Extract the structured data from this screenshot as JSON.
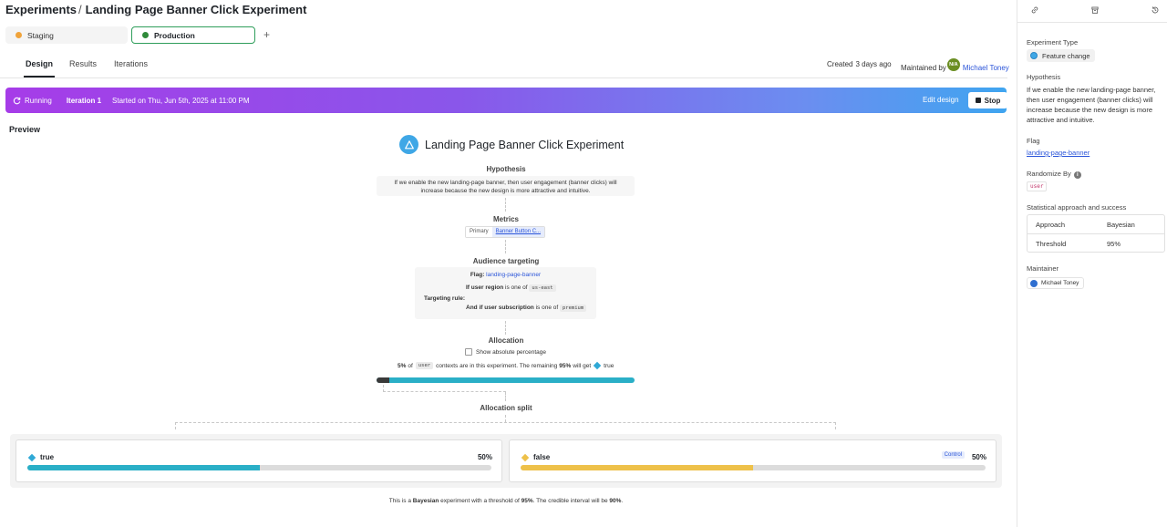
{
  "breadcrumb": {
    "root": "Experiments",
    "separator": "/",
    "current": "Landing Page Banner Click Experiment"
  },
  "environments": [
    {
      "name": "Staging",
      "color": "#f0a33a",
      "active": false
    },
    {
      "name": "Production",
      "color": "#2f8a3a",
      "active": true
    }
  ],
  "env_add_label": "+",
  "tabs": {
    "design": "Design",
    "results": "Results",
    "iterations": "Iterations",
    "active": "Design"
  },
  "meta": {
    "created_label": "Created",
    "created_value": "3 days ago",
    "maintained_by_label": "Maintained by",
    "avatar_initials": "N/A",
    "maintainer_name": "Michael Toney"
  },
  "banner": {
    "status": "Running",
    "iteration": "Iteration 1",
    "started": "Started on Thu, Jun 5th, 2025 at 11:00 PM",
    "edit_label": "Edit design",
    "stop_label": "Stop"
  },
  "preview": {
    "label": "Preview",
    "title": "Landing Page Banner Click Experiment",
    "hypothesis_title": "Hypothesis",
    "hypothesis_line1": "If we enable the new landing-page banner, then user engagement (banner clicks) will",
    "hypothesis_line2": "increase because the new design is more attractive and intuitive.",
    "metrics_title": "Metrics",
    "metric_primary_label": "Primary",
    "metric_primary_value": "Banner Button C...",
    "audience_title": "Audience targeting",
    "audience_flag_label": "Flag:",
    "audience_flag_value": "landing-page-banner",
    "targeting_rule_label": "Targeting rule:",
    "cond1": {
      "prefix": "If",
      "attr": "user region",
      "op": "is one of",
      "value": "us-east"
    },
    "cond2": {
      "prefix": "And if",
      "attr": "user subscription",
      "op": "is one of",
      "value": "premium"
    },
    "allocation_title": "Allocation",
    "show_absolute_label": "Show absolute percentage",
    "alloc_pct": "5%",
    "alloc_of": "of",
    "alloc_context": "user",
    "alloc_mid": "contexts are in this experiment. The remaining",
    "alloc_remaining": "95%",
    "alloc_will_get": "will get",
    "alloc_default": "true",
    "alloc_fraction": 0.05,
    "split_title": "Allocation split",
    "variations": [
      {
        "name": "true",
        "percent": "50%",
        "fraction": 0.5,
        "color": "#2aafc7",
        "control": false
      },
      {
        "name": "false",
        "percent": "50%",
        "fraction": 0.5,
        "color": "#eec14a",
        "control": true,
        "control_label": "Control"
      }
    ],
    "footer": {
      "t1": "This is a",
      "approach": "Bayesian",
      "t2": "experiment with a threshold of",
      "threshold": "95%",
      "t3": ". The credible interval will be",
      "interval": "90%",
      "t4": "."
    }
  },
  "sidebar": {
    "type_label": "Experiment Type",
    "type_value": "Feature change",
    "hypothesis_label": "Hypothesis",
    "hypothesis_text": "If we enable the new landing-page banner, then user engagement (banner clicks) will increase because the new design is more attractive and intuitive.",
    "flag_label": "Flag",
    "flag_value": "landing-page-banner",
    "randomize_label": "Randomize By",
    "randomize_value": "user",
    "stat_label": "Statistical approach and success",
    "stat_rows": [
      {
        "key": "Approach",
        "value": "Bayesian"
      },
      {
        "key": "Threshold",
        "value": "95%"
      }
    ],
    "maintainer_label": "Maintainer",
    "maintainer_value": "Michael Toney"
  },
  "colors": {
    "accent_link": "#2b55d9",
    "production_border": "#2f9e5b",
    "banner_start": "#a63ce8",
    "banner_end": "#3fa5f0"
  },
  "icons": {
    "link": "link-icon",
    "archive": "archive-icon",
    "history": "history-icon",
    "running": "refresh-icon",
    "stop": "stop-icon",
    "experiment": "flask-icon"
  }
}
